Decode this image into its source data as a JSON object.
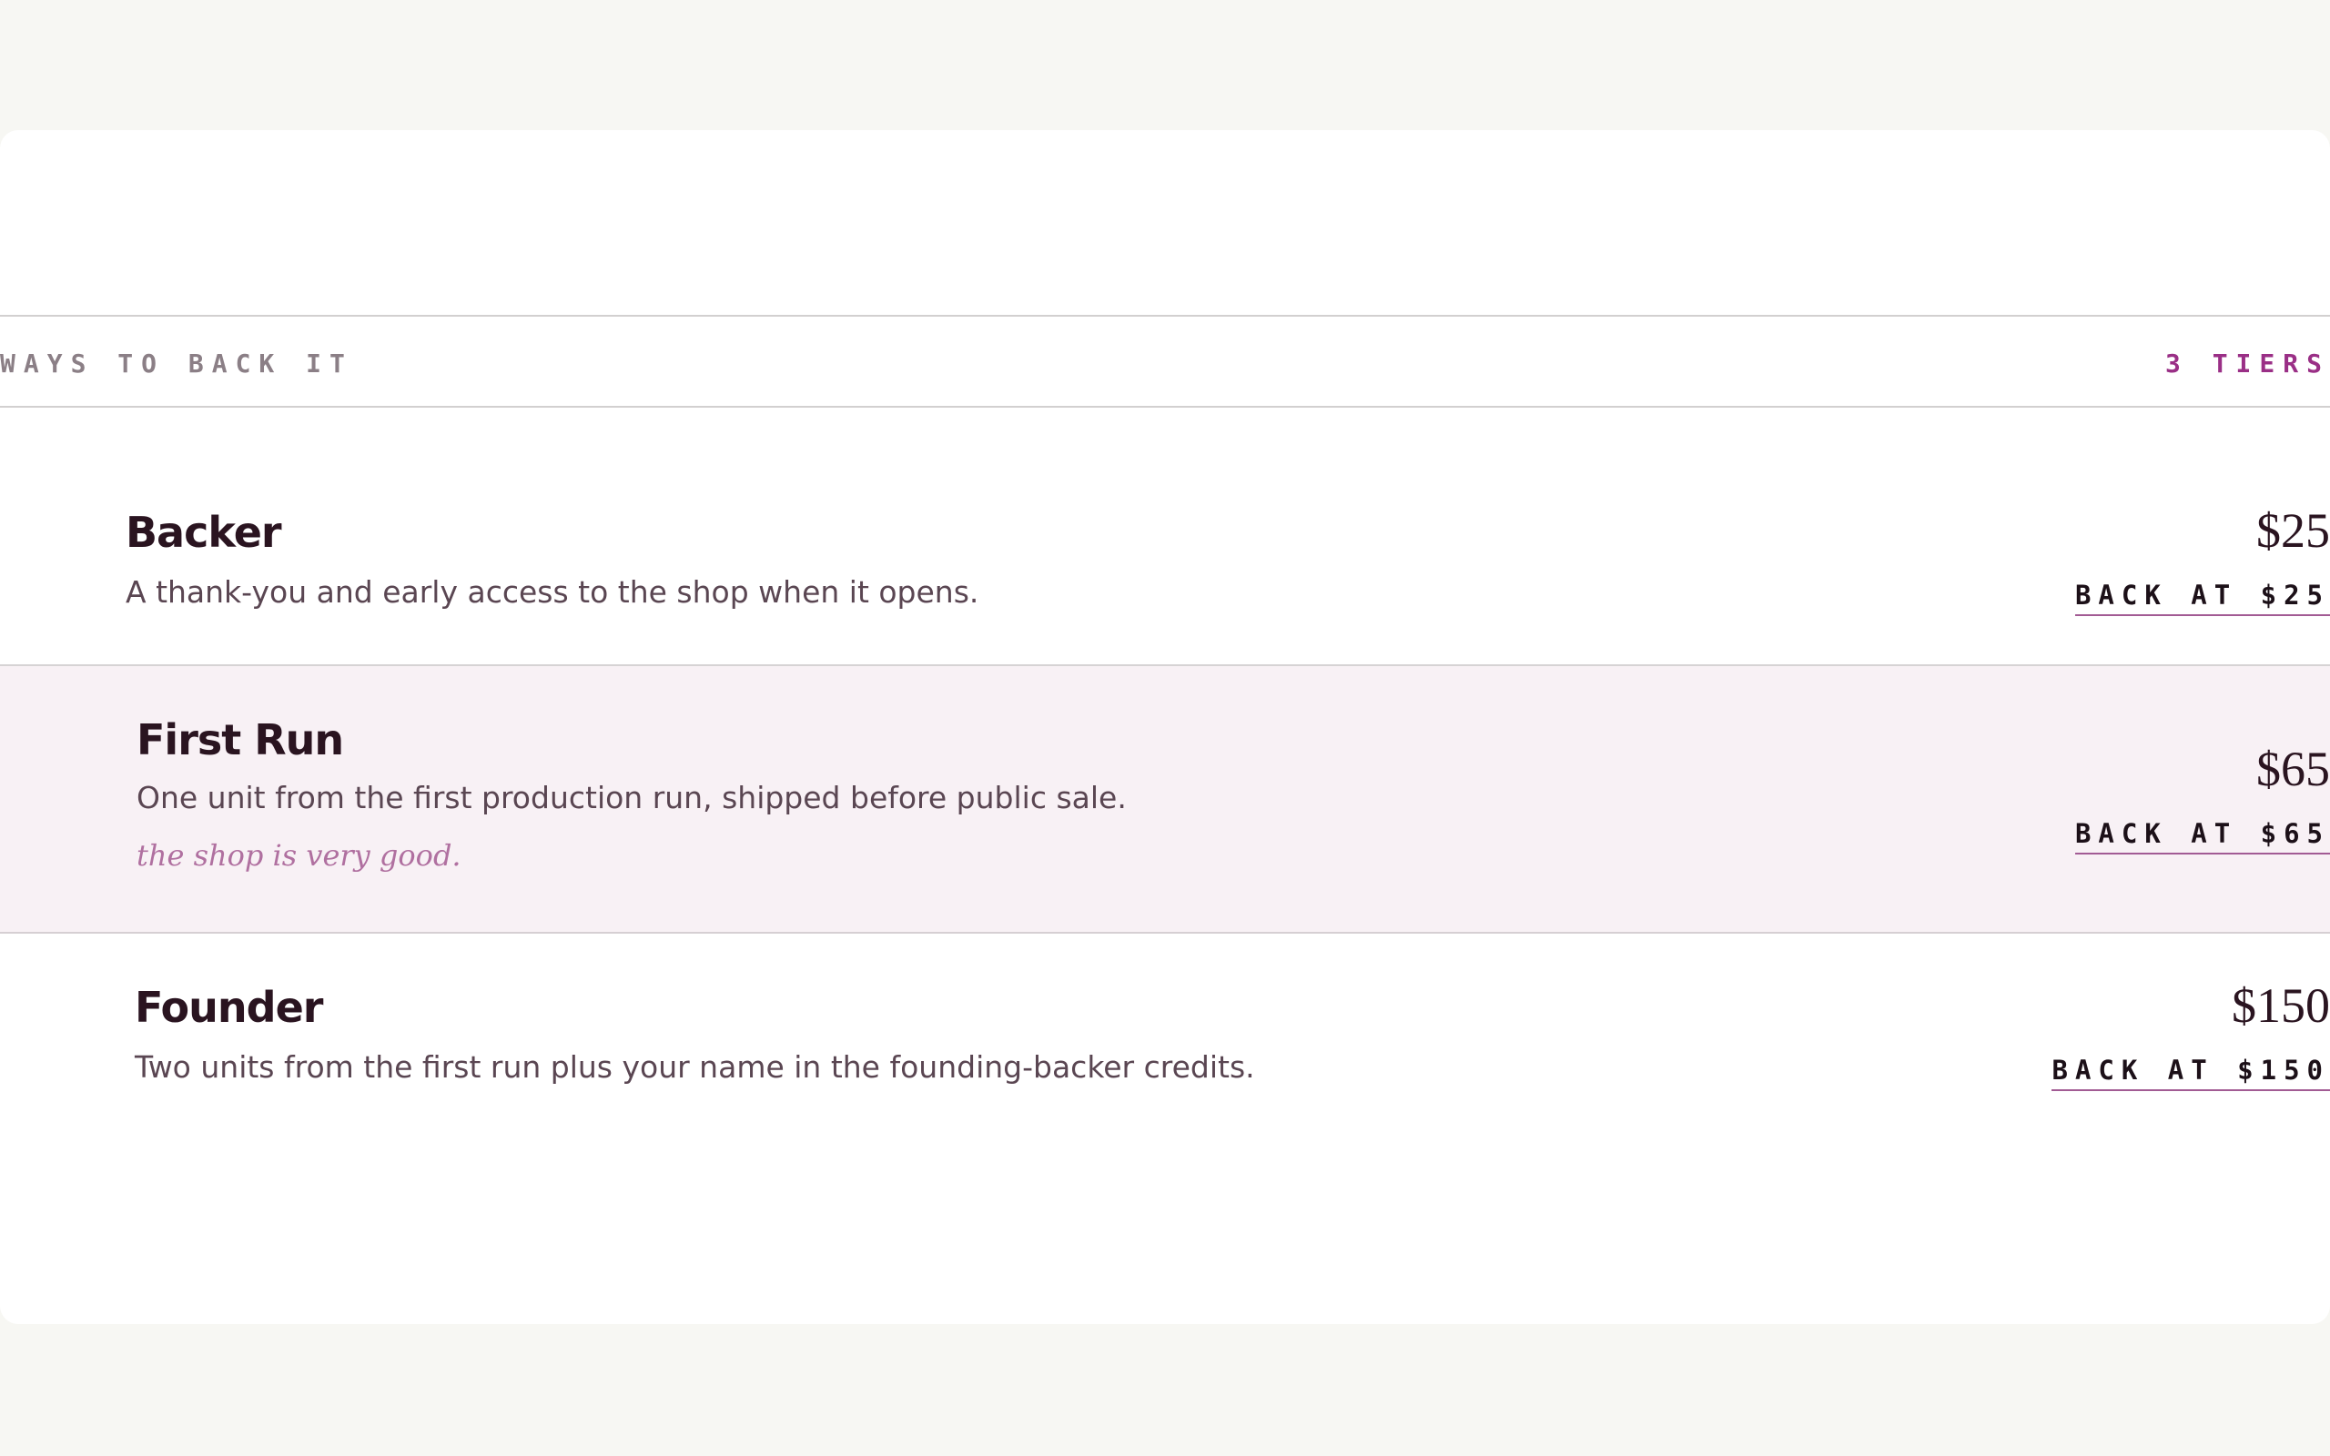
{
  "section": {
    "title": "WAYS TO BACK IT",
    "count": "3 TIERS"
  },
  "tiers": [
    {
      "name": "Backer",
      "description": "A thank-you and early access to the shop when it opens.",
      "price": "$25",
      "cta": "BACK AT $25"
    },
    {
      "name": "First Run",
      "description": "One unit from the first production run, shipped before public sale.",
      "note": "the shop is very good.",
      "price": "$65",
      "cta": "BACK AT $65",
      "highlighted": true
    },
    {
      "name": "Founder",
      "description": "Two units from the first run plus your name in the founding-backer credits.",
      "price": "$150",
      "cta": "BACK AT $150"
    }
  ],
  "colors": {
    "page_background": "#f7f7f3",
    "card_background": "#ffffff",
    "highlight_background": "#f8f1f5",
    "accent": "#9a2f86",
    "text_dark": "#2a1420"
  }
}
